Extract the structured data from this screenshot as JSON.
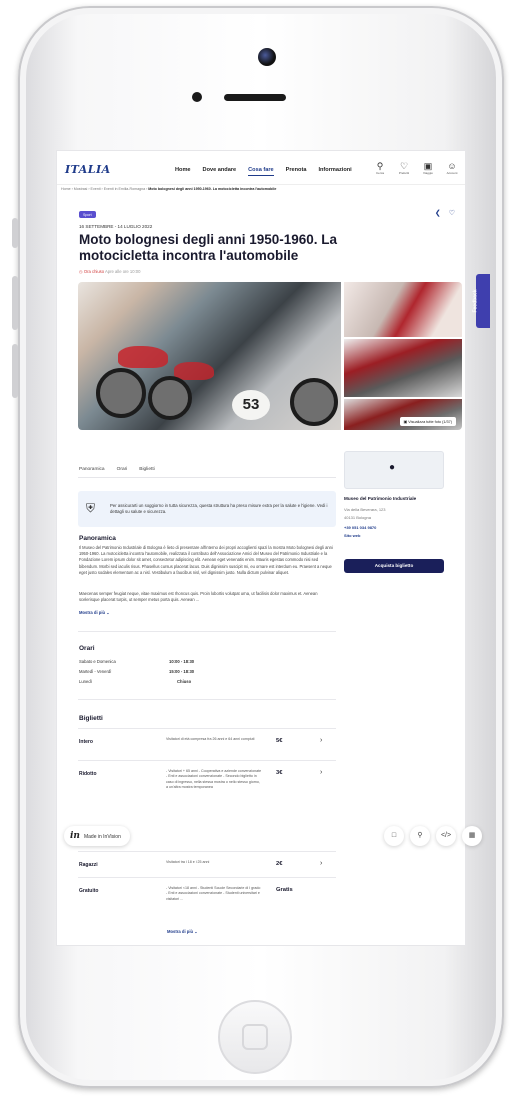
{
  "nav": {
    "logo": "ITALIA",
    "menu": [
      "Home",
      "Dove andare",
      "Cosa fare",
      "Prenota",
      "Informazioni"
    ],
    "active_menu_index": 2,
    "icons": [
      {
        "icon": "search-icon",
        "label": "Cerca"
      },
      {
        "icon": "heart-icon",
        "label": "Preferiti"
      },
      {
        "icon": "bag-icon",
        "label": "Viaggio"
      },
      {
        "icon": "user-icon",
        "label": "Account"
      }
    ]
  },
  "breadcrumb": {
    "path": "Home › Mostrasi › Eventi › Eventi in Emilia-Romagna › ",
    "current": "Moto bolognesi degli anni 1950-1960. La motocicletta incontra l'automobile"
  },
  "event": {
    "badge": "Sport",
    "dates": "16 SETTEMBRE - 14 LUGLIO 2022",
    "title": "Moto bolognesi degli anni 1950-1960. La motocicletta incontra l'automobile",
    "status_closed": "Ora chiuso",
    "status_rest": "Apre alle ore 10:00",
    "photo_button": "Visualizza tutte foto (1/37)",
    "photo_number": "53"
  },
  "tabs": [
    "Panoramica",
    "Orari",
    "Biglietti"
  ],
  "safety": {
    "text": "Per assicurarti un soggiorno in tutta sicurezza, questa struttura ha preso misure extra per la salute e l'igiene. Vedi i dettagli su salute e sicurezza."
  },
  "panoramica": {
    "heading": "Panoramica",
    "text1": "Il Museo del Patrimonio Industriale di Bologna è lieto di presentare all'interno dei propri accoglienti spazi la mostra Moto bolognesi degli anni 1950-1960. La motocicletta incontra l'automobile, realizzata il contributo dell'Associazione Amici del Museo del Patrimonio Industriale e la Fondazione Lorem ipsum dolor sit amet, consectetur adipiscing elit. Aenean eget venenatis enim. Mauris egestas commodo nisi sed bibendum. Morbi sed iaculis risus. Phasellus cursus placerat lacus. Duis dignissim suscipit mi, eu ornare est interdum eu. Praesent a neque eget justo sodales elementum ac a nisl. Vestibulum a faucibus nisl, vel dignissim justo. Nulla dictum pulvinar aliquet.",
    "text2": "Maecenas semper feugiat neque, vitae maximus est rhoncus quis. Proin lobortis volutpat urna, ut facilisis dolor maximus et. Aenean scelerisque placerat turpis, ut semper metus porta quis. Aenean ...",
    "more": "Mostra di più"
  },
  "orari": {
    "heading": "Orari",
    "rows": [
      {
        "day": "Sabato e Domenica",
        "time": "10:00 - 18:30"
      },
      {
        "day": "Martedì - Venerdì",
        "time": "15:00 - 18:30"
      },
      {
        "day": "Lunedì",
        "time": "Chiuso"
      }
    ]
  },
  "biglietti": {
    "heading": "Biglietti",
    "rows": [
      {
        "name": "Intero",
        "desc": "Visitatori di età compresa fra 26 anni e 64 anni compiuti",
        "price": "5€"
      },
      {
        "name": "Ridotto",
        "desc": "- Visitatori + 65 anni - Cooperativa e aziende convenzionate - Enti e associazioni convenzionate - Secondo biglietto in caso di ingresso, nella stessa mostra o nello stesso giorno, a un'altra mostra temporanea",
        "price": "3€"
      },
      {
        "name": "Ragazzi",
        "desc": "Visitatori tra i 18 e i 25 anni",
        "price": "2€"
      },
      {
        "name": "Gratuito",
        "desc": "- Visitatori <18 anni - Studenti Scuole Secondarie di I grado - Enti e associazioni convenzionate - Studenti universitari e visitatori ...",
        "price": "Gratis"
      }
    ],
    "more": "Mostra di più"
  },
  "venue": {
    "name": "Museo del Patrimonio Industriale",
    "address1": "Via della Beverara, 123",
    "address2": "40131 Bologna",
    "phone": "+39 051 034 9870",
    "website": "Sito web",
    "buy_button": "Acquista biglietto"
  },
  "overlay": {
    "feedback": "Feedback",
    "invision_logo": "in",
    "invision_text": "Made in InVision",
    "tools": [
      "comment-icon",
      "search-icon",
      "code-icon",
      "grid-icon"
    ]
  }
}
